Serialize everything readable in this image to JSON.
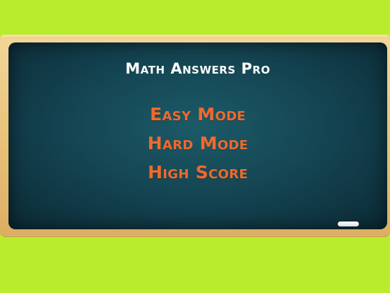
{
  "app": {
    "title": "Math Answers Pro"
  },
  "menu": {
    "items": [
      {
        "label": "Easy Mode"
      },
      {
        "label": "Hard Mode"
      },
      {
        "label": "High Score"
      }
    ]
  },
  "colors": {
    "background": "#b9ec2b",
    "frame": "#e9c27a",
    "chalkboard": "#154654",
    "title": "#ffffff",
    "menu_text": "#ef6a2c"
  },
  "icons": {
    "chalk": "chalk-icon"
  }
}
